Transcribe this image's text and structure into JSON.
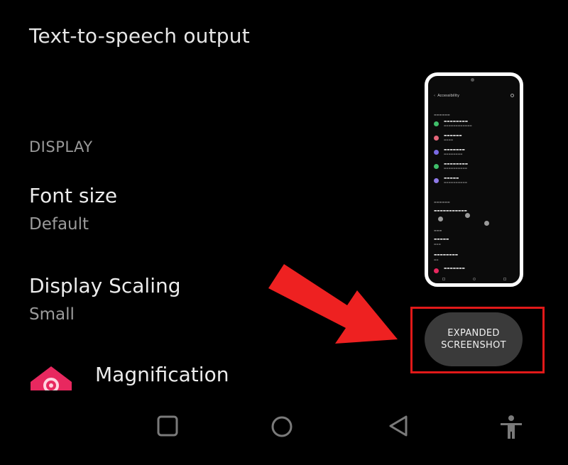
{
  "tts": {
    "label": "Text-to-speech output"
  },
  "display": {
    "section_label": "DISPLAY",
    "font_size": {
      "title": "Font size",
      "value": "Default"
    },
    "display_scaling": {
      "title": "Display Scaling",
      "value": "Small"
    },
    "magnification": {
      "title": "Magnification",
      "icon": "magnification-icon",
      "icon_color": "#e8285f"
    }
  },
  "preview": {
    "header": "Accessibility",
    "icon": "search-icon"
  },
  "expanded_button": {
    "line1": "EXPANDED",
    "line2": "SCREENSHOT"
  },
  "annotation": {
    "arrow_color": "#ee2121",
    "highlight_color": "#e11919"
  },
  "navbar": {
    "icons": [
      "recents-square-icon",
      "home-circle-icon",
      "back-triangle-icon",
      "accessibility-person-icon"
    ]
  }
}
